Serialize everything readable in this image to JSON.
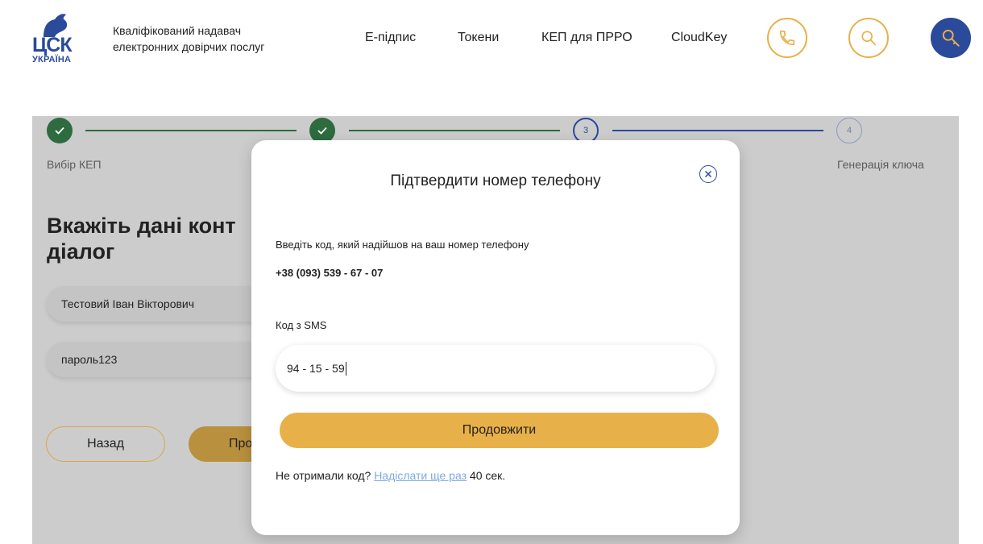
{
  "header": {
    "logo": {
      "main": "ЦСК",
      "sub": "УКРАЇНА"
    },
    "tagline": "Кваліфікований надавач електронних довірчих послуг",
    "nav": [
      "Е-підпис",
      "Токени",
      "КЕП для ПРРО",
      "CloudKey"
    ],
    "icons": {
      "phone": "phone-icon",
      "search": "search-icon",
      "key": "key-icon"
    },
    "colors": {
      "accent": "#e8b048",
      "brand": "#2b4a9a"
    }
  },
  "stepper": {
    "steps": [
      {
        "label": "Вибір КЕП",
        "status": "done",
        "number": "1"
      },
      {
        "label": "",
        "status": "done",
        "number": "2"
      },
      {
        "label": "",
        "status": "current",
        "number": "3"
      },
      {
        "label": "Генерація ключа",
        "status": "todo",
        "number": "4"
      }
    ]
  },
  "page": {
    "heading": "Вкажіть дані конт… діалог",
    "heading_line1": "Вкажіть дані конт",
    "heading_line2": "діалог",
    "fields": {
      "name_value": "Тестовий Іван Вікторович",
      "password_value": "пароль123"
    },
    "back_label": "Назад",
    "next_label_partial": "Про"
  },
  "modal": {
    "title": "Підтвердити номер телефону",
    "instruction": "Введіть код, який надійшов на ваш номер телефону",
    "phone": "+38 (093) 539 - 67 - 07",
    "sms_label": "Код з SMS",
    "sms_value": "94 - 15 - 59",
    "continue_label": "Продовжити",
    "resend_prefix": "Не отримали код?",
    "resend_link": "Надіслати ще раз",
    "resend_timer": "40 сек."
  }
}
